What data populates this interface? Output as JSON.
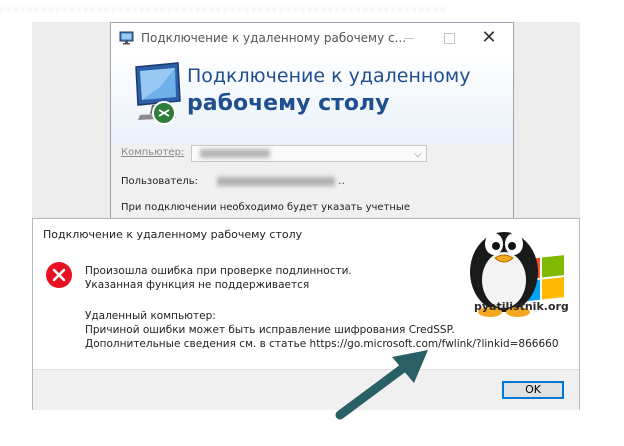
{
  "rdp_window": {
    "title": "Подключение к удаленному рабочему с...",
    "banner_line1": "Подключение к удаленному",
    "banner_line2": "рабочему столу",
    "computer_label": "Компьютер:",
    "user_label": "Пользователь:",
    "user_suffix": "..",
    "note": "При подключении необходимо будет указать учетные",
    "close_glyph": "✕",
    "combo_arrow": "⌵"
  },
  "error_dialog": {
    "title": "Подключение к удаленному рабочему столу",
    "line1": "Произошла ошибка при проверке подлинности.",
    "line2": "Указанная функция не поддерживается",
    "line3": "Удаленный компьютер:",
    "line4": "Причиной ошибки может быть исправление шифрования CredSSP.",
    "line5": "Дополнительные сведения см. в статье https://go.microsoft.com/fwlink/?linkid=866660",
    "ok_label": "OK"
  },
  "logo": {
    "text": "pyatilistnik.org"
  },
  "icons": {
    "rdp_app": "remote-desktop-icon",
    "error": "error-x-icon",
    "arrow": "pointer-arrow"
  },
  "colors": {
    "banner_text": "#1f4f8e",
    "error_red": "#e81123",
    "arrow": "#2a5f66",
    "ok_border": "#0078d7"
  }
}
